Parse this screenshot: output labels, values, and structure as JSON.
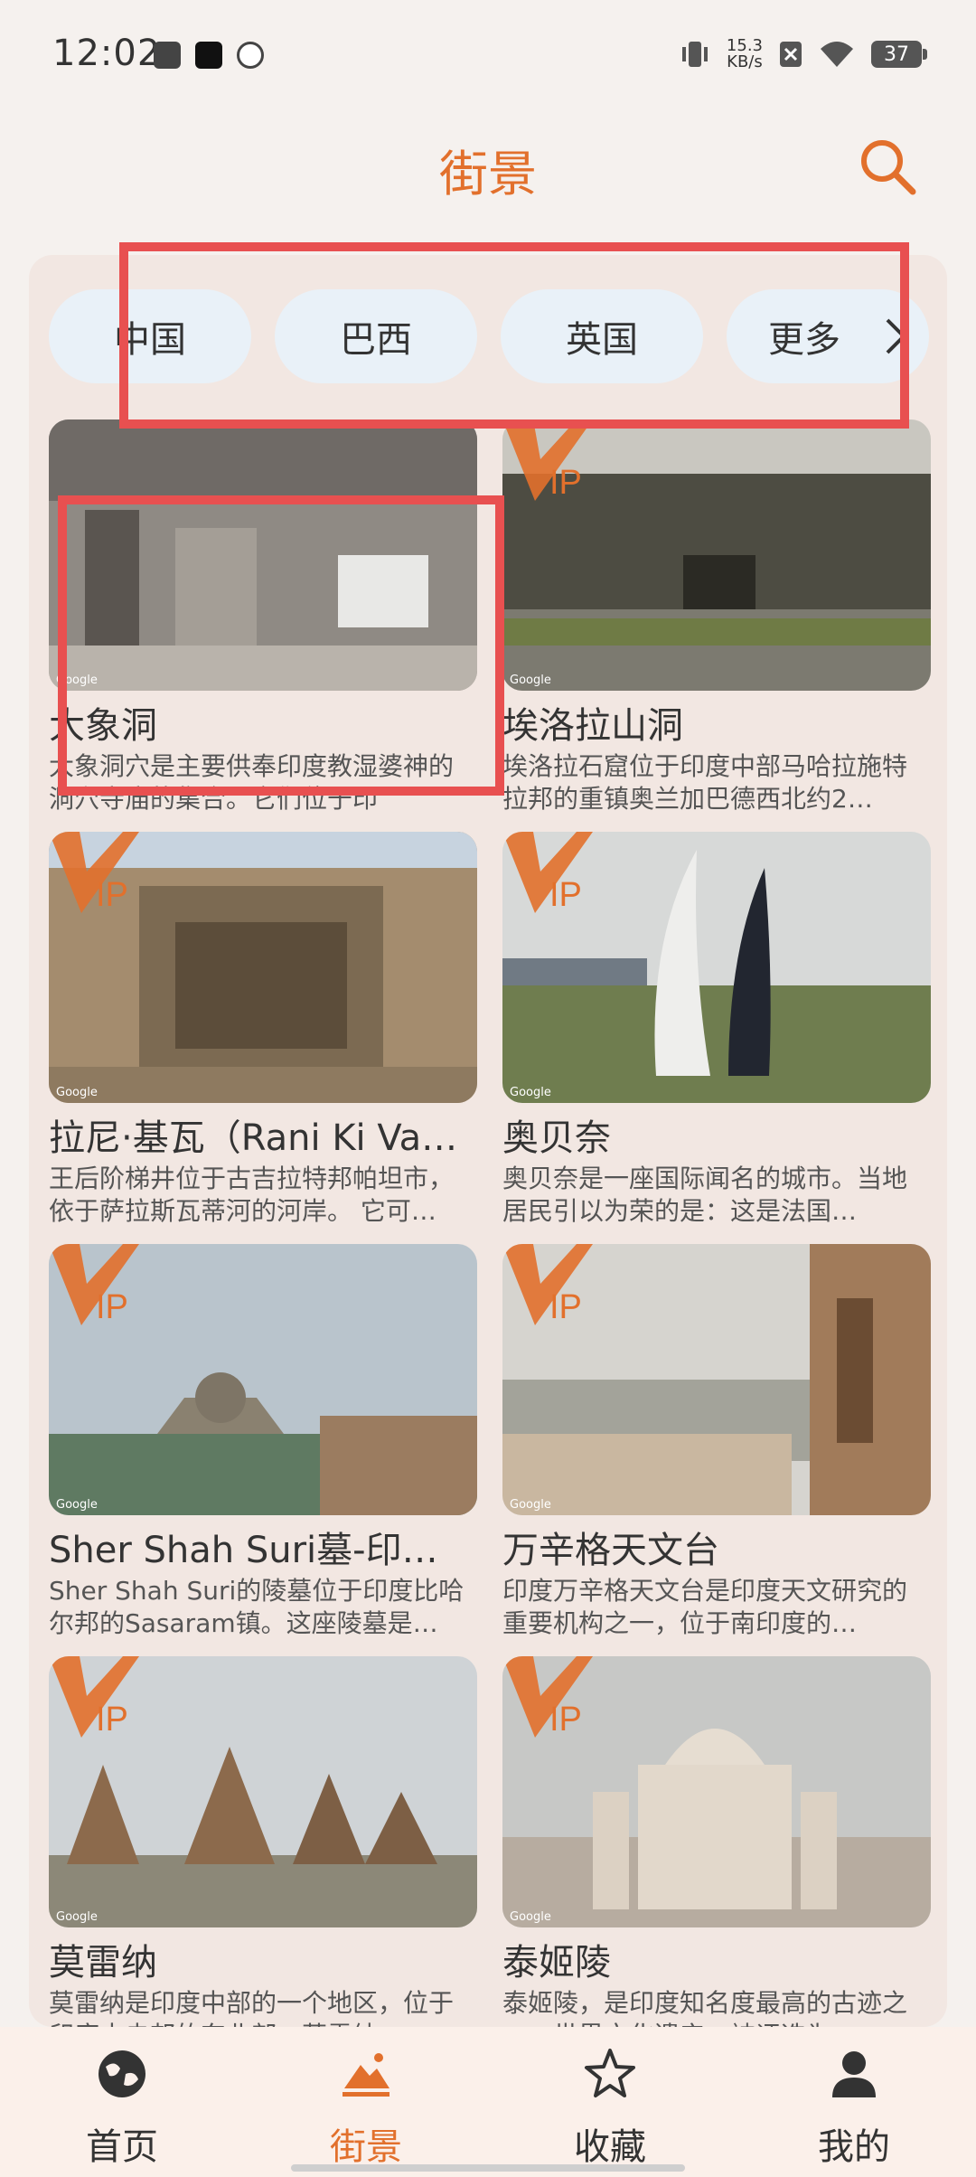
{
  "status_bar": {
    "time": "12:02",
    "net_speed_top": "15.3",
    "net_speed_bottom": "KB/s",
    "battery": "37"
  },
  "header": {
    "title": "街景",
    "search_icon": "search-icon"
  },
  "countries": [
    {
      "label": "中国"
    },
    {
      "label": "巴西"
    },
    {
      "label": "英国"
    },
    {
      "label": "更多"
    }
  ],
  "places": [
    {
      "name": "大象洞",
      "desc": "大象洞穴是主要供奉印度教湿婆神的洞穴寺庙的集合。它们位于印",
      "vip": false
    },
    {
      "name": "埃洛拉山洞",
      "desc": "埃洛拉石窟位于印度中部马哈拉施特拉邦的重镇奥兰加巴德西北约2…",
      "vip": true
    },
    {
      "name": "拉尼·基瓦（Rani Ki Vav）",
      "desc": "王后阶梯井位于古吉拉特邦帕坦市，依于萨拉斯瓦蒂河的河岸。 它可…",
      "vip": true
    },
    {
      "name": "奥贝奈",
      "desc": "奥贝奈是一座国际闻名的城市。当地居民引以为荣的是：这是法国…",
      "vip": true
    },
    {
      "name": "Sher Shah Suri墓-印…",
      "desc": "Sher Shah Suri的陵墓位于印度比哈尔邦的Sasaram镇。这座陵墓是…",
      "vip": true
    },
    {
      "name": "万辛格天文台",
      "desc": "印度万辛格天文台是印度天文研究的重要机构之一，位于南印度的…",
      "vip": true
    },
    {
      "name": "莫雷纳",
      "desc": "莫雷纳是印度中部的一个地区，位于印度中央邦的东北部，莫雷纳…",
      "vip": true
    },
    {
      "name": "泰姬陵",
      "desc": "泰姬陵，是印度知名度最高的古迹之一，世界文化遗产，被评选为…",
      "vip": true
    }
  ],
  "image_credit": "Google",
  "bottom_nav": [
    {
      "label": "首页",
      "icon": "globe-icon",
      "active": false
    },
    {
      "label": "街景",
      "icon": "street-view-icon",
      "active": true
    },
    {
      "label": "收藏",
      "icon": "star-icon",
      "active": false
    },
    {
      "label": "我的",
      "icon": "person-icon",
      "active": false
    }
  ],
  "colors": {
    "accent": "#e2702c",
    "chip_bg": "#e9f1f8",
    "panel_bg": "#f2e7e2",
    "highlight": "#e85050"
  }
}
